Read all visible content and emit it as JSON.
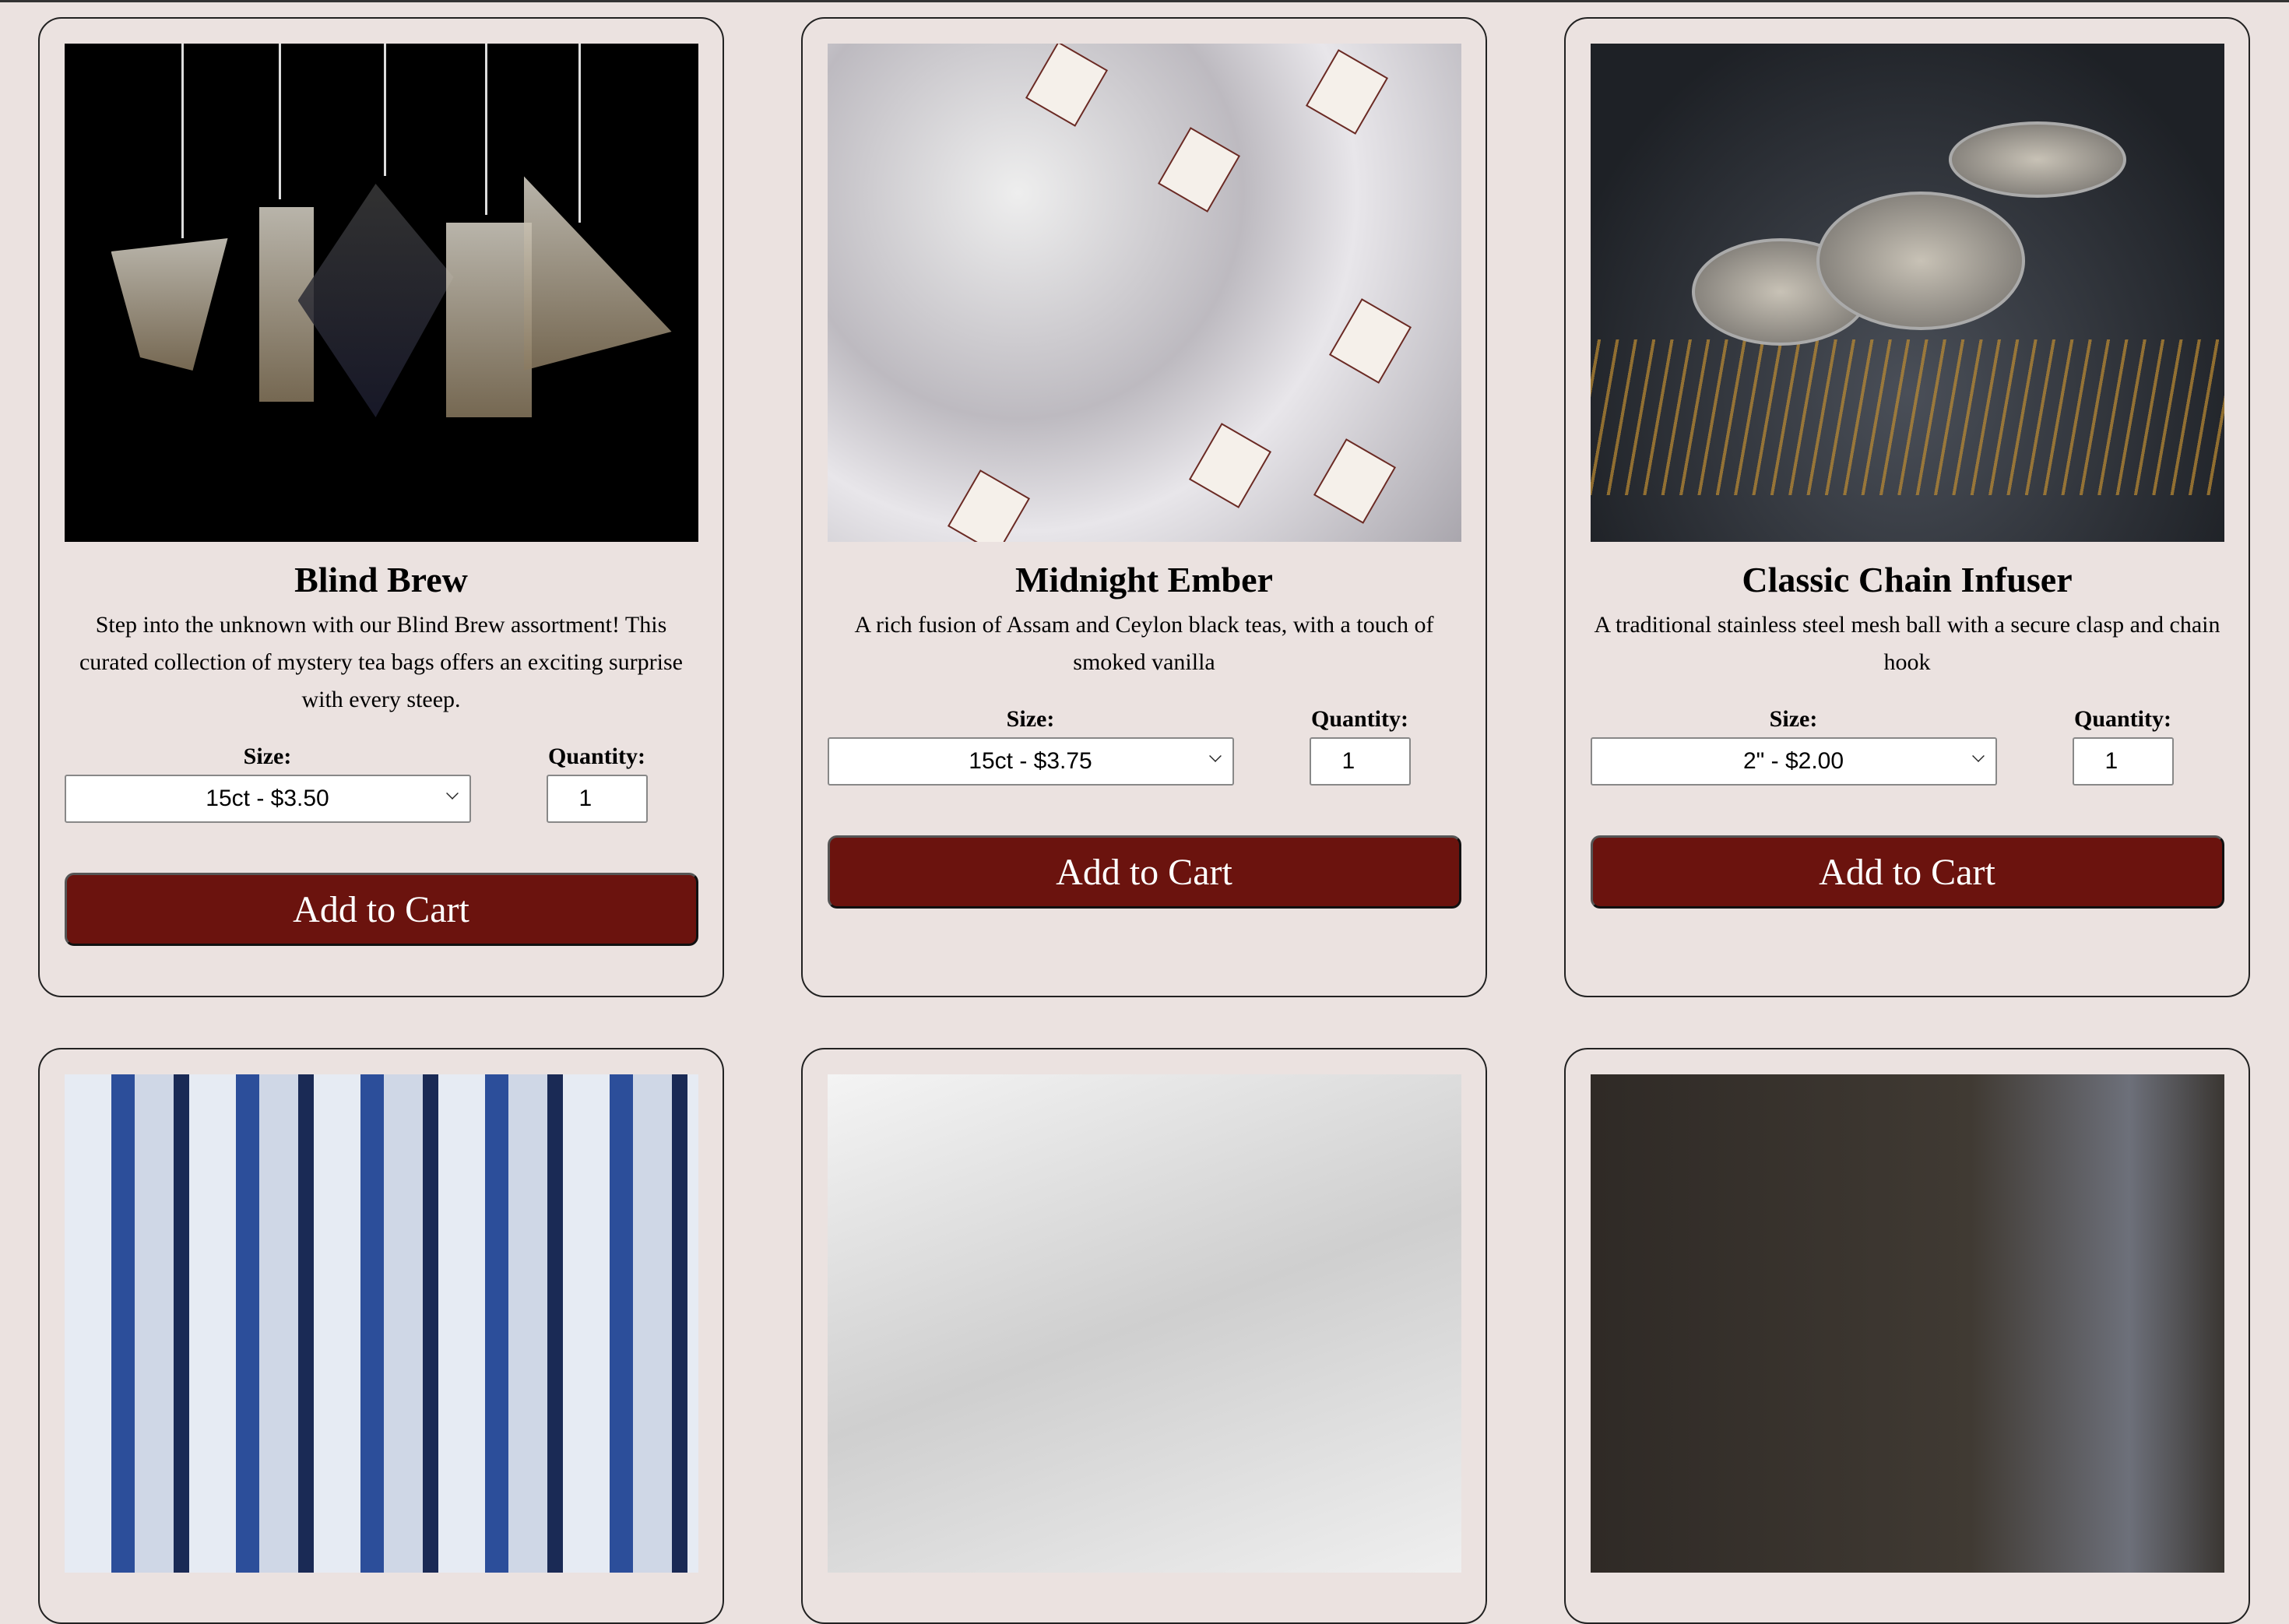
{
  "labels": {
    "size": "Size:",
    "quantity": "Quantity:",
    "add_to_cart": "Add to Cart"
  },
  "products": [
    {
      "name": "Blind Brew",
      "description": "Step into the unknown with our Blind Brew assortment! This curated collection of mystery tea bags offers an exciting surprise with every steep.",
      "size": "15ct - $3.50",
      "quantity": "1"
    },
    {
      "name": "Midnight Ember",
      "description": "A rich fusion of Assam and Ceylon black teas, with a touch of smoked vanilla",
      "size": "15ct - $3.75",
      "quantity": "1"
    },
    {
      "name": "Classic Chain Infuser",
      "description": "A traditional stainless steel mesh ball with a secure clasp and chain hook",
      "size": "2\" - $2.00",
      "quantity": "1"
    }
  ],
  "colors": {
    "background": "#ebe2e0",
    "button": "#6b130e"
  }
}
